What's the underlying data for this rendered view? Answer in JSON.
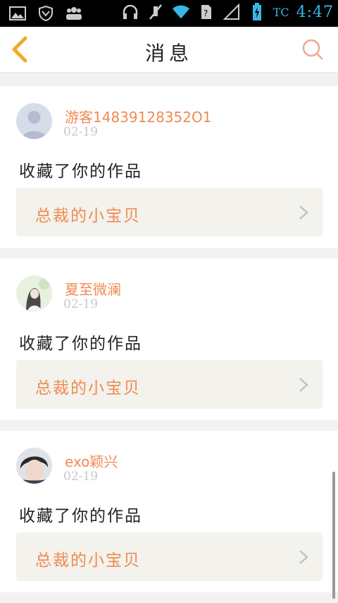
{
  "status_bar": {
    "icons_left": [
      "image-icon",
      "shield-icon",
      "people-icon"
    ],
    "icons_right": [
      "headphones-icon",
      "mute-icon",
      "wifi-icon",
      "sim-icon",
      "signal-icon",
      "battery-icon"
    ],
    "carrier": "TC",
    "time": "4:47"
  },
  "header": {
    "title": "消息",
    "back_icon": "chevron-left-icon",
    "search_icon": "search-icon",
    "accent_color": "#f0a830"
  },
  "messages": [
    {
      "username": "游客14839128352O1",
      "date": "02-19",
      "action": "收藏了你的作品",
      "work_title": "总裁的小宝贝",
      "avatar": "default-avatar"
    },
    {
      "username": "夏至微澜",
      "date": "02-19",
      "action": "收藏了你的作品",
      "work_title": "总裁的小宝贝",
      "avatar": "illustrated-avatar"
    },
    {
      "username": "exo颖兴",
      "date": "02-19",
      "action": "收藏了你的作品",
      "work_title": "总裁的小宝贝",
      "avatar": "photo-avatar"
    }
  ],
  "colors": {
    "username": "#f08a53",
    "work_title": "#f08a53",
    "link_bg": "#f3f2ec"
  }
}
